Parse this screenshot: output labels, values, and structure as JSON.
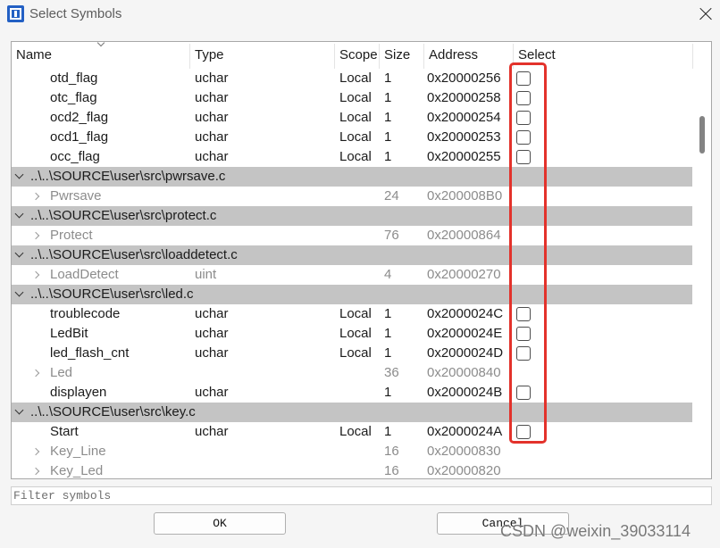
{
  "window": {
    "title": "Select Symbols"
  },
  "icons": {
    "app": "jlink-app-icon",
    "close": "close-icon",
    "sort": "chevron-down-icon",
    "group_expander": "chevron-down-icon",
    "item_expander": "chevron-right-icon"
  },
  "table": {
    "columns": {
      "name": "Name",
      "type": "Type",
      "scope": "Scope",
      "size": "Size",
      "address": "Address",
      "select": "Select"
    },
    "rows": [
      {
        "name": "otd_flag",
        "type": "uchar",
        "scope": "Local",
        "size": "1",
        "address": "0x20000256",
        "checkbox": true,
        "checked": false
      },
      {
        "name": "otc_flag",
        "type": "uchar",
        "scope": "Local",
        "size": "1",
        "address": "0x20000258",
        "checkbox": true,
        "checked": false
      },
      {
        "name": "ocd2_flag",
        "type": "uchar",
        "scope": "Local",
        "size": "1",
        "address": "0x20000254",
        "checkbox": true,
        "checked": false
      },
      {
        "name": "ocd1_flag",
        "type": "uchar",
        "scope": "Local",
        "size": "1",
        "address": "0x20000253",
        "checkbox": true,
        "checked": false
      },
      {
        "name": "occ_flag",
        "type": "uchar",
        "scope": "Local",
        "size": "1",
        "address": "0x20000255",
        "checkbox": true,
        "checked": false
      },
      {
        "group": true,
        "expanded": true,
        "name": "..\\..\\SOURCE\\user\\src\\pwrsave.c"
      },
      {
        "expandable": true,
        "expanded": false,
        "name": "Pwrsave",
        "size": "24",
        "address": "0x200008B0"
      },
      {
        "group": true,
        "expanded": true,
        "name": "..\\..\\SOURCE\\user\\src\\protect.c"
      },
      {
        "expandable": true,
        "expanded": false,
        "name": "Protect",
        "size": "76",
        "address": "0x20000864"
      },
      {
        "group": true,
        "expanded": true,
        "name": "..\\..\\SOURCE\\user\\src\\loaddetect.c"
      },
      {
        "expandable": true,
        "expanded": false,
        "name": "LoadDetect",
        "type": "uint",
        "size": "4",
        "address": "0x20000270"
      },
      {
        "group": true,
        "expanded": true,
        "name": "..\\..\\SOURCE\\user\\src\\led.c"
      },
      {
        "name": "troublecode",
        "type": "uchar",
        "scope": "Local",
        "size": "1",
        "address": "0x2000024C",
        "checkbox": true,
        "checked": false
      },
      {
        "name": "LedBit",
        "type": "uchar",
        "scope": "Local",
        "size": "1",
        "address": "0x2000024E",
        "checkbox": true,
        "checked": false
      },
      {
        "name": "led_flash_cnt",
        "type": "uchar",
        "scope": "Local",
        "size": "1",
        "address": "0x2000024D",
        "checkbox": true,
        "checked": false
      },
      {
        "expandable": true,
        "expanded": false,
        "name": "Led",
        "size": "36",
        "address": "0x20000840"
      },
      {
        "name": "displayen",
        "type": "uchar",
        "size": "1",
        "address": "0x2000024B",
        "checkbox": true,
        "checked": false
      },
      {
        "group": true,
        "expanded": true,
        "name": "..\\..\\SOURCE\\user\\src\\key.c"
      },
      {
        "name": "Start",
        "type": "uchar",
        "scope": "Local",
        "size": "1",
        "address": "0x2000024A",
        "checkbox": true,
        "checked": false
      },
      {
        "expandable": true,
        "expanded": false,
        "name": "Key_Line",
        "size": "16",
        "address": "0x20000830"
      },
      {
        "expandable": true,
        "expanded": false,
        "name": "Key_Led",
        "size": "16",
        "address": "0x20000820"
      }
    ]
  },
  "filter": {
    "placeholder": "Filter symbols"
  },
  "buttons": {
    "ok": "OK",
    "cancel": "Cancel"
  },
  "watermark": {
    "text": "CSDN @weixin_39033114"
  },
  "colors": {
    "annotation": "#e3322b",
    "group_row_bg": "#c4c4c4",
    "dimmed_text": "#8c8c8c"
  }
}
